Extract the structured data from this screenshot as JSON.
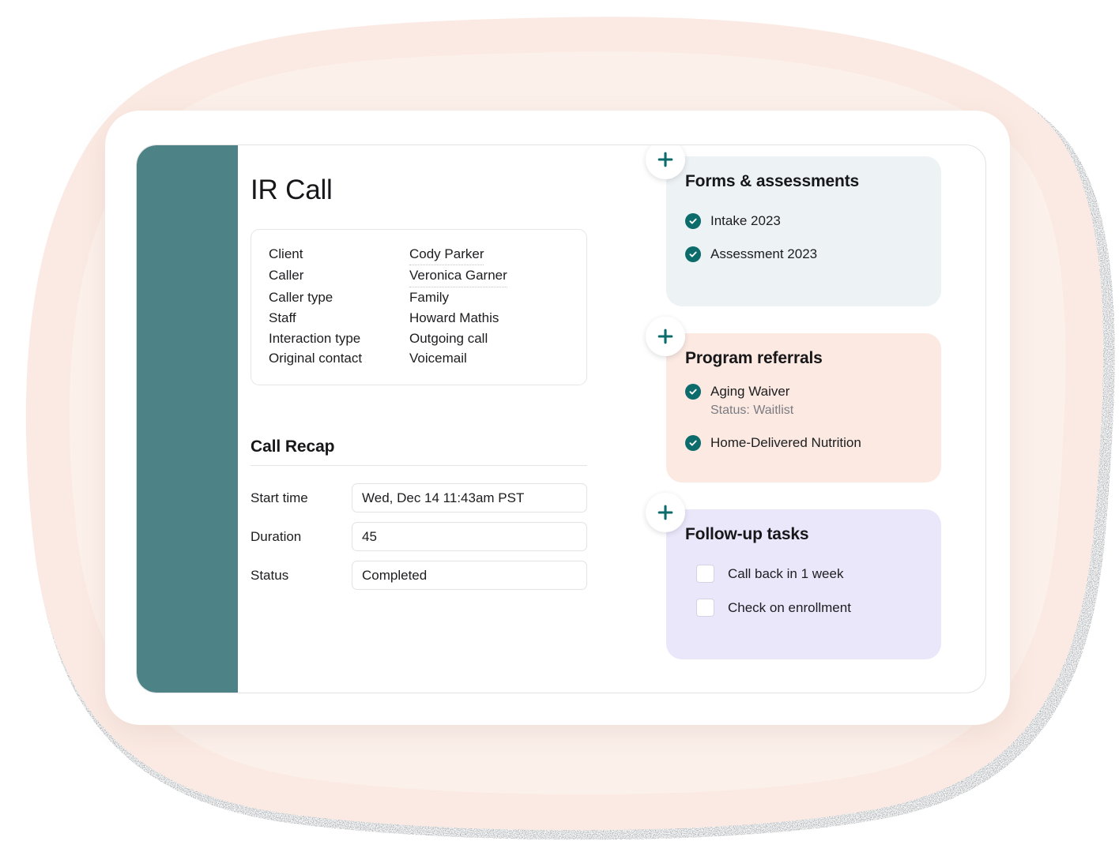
{
  "theme": {
    "rail_color": "#4d8386",
    "accent_teal": "#0c6b6b",
    "frame_color": "#ffffff",
    "blob_color": "#fbe9e2",
    "blob_shadow": "#2e3338",
    "card_forms_bg": "#edf2f5",
    "card_referrals_bg": "#fbe9e2",
    "card_tasks_bg": "#eae7fb"
  },
  "page": {
    "title": "IR Call"
  },
  "details": {
    "rows": [
      {
        "label": "Client",
        "value": "Cody Parker",
        "link": true
      },
      {
        "label": "Caller",
        "value": "Veronica Garner",
        "link": true
      },
      {
        "label": "Caller type",
        "value": "Family",
        "link": false
      },
      {
        "label": "Staff",
        "value": "Howard Mathis",
        "link": false
      },
      {
        "label": "Interaction type",
        "value": "Outgoing call",
        "link": false
      },
      {
        "label": "Original contact",
        "value": "Voicemail",
        "link": false
      }
    ]
  },
  "recap": {
    "heading": "Call Recap",
    "fields": [
      {
        "label": "Start time",
        "value": "Wed, Dec 14 11:43am PST"
      },
      {
        "label": "Duration",
        "value": "45"
      },
      {
        "label": "Status",
        "value": "Completed"
      }
    ]
  },
  "cards": {
    "forms": {
      "title": "Forms & assessments",
      "add_label": "+",
      "items": [
        {
          "label": "Intake 2023",
          "checked": true,
          "sub": ""
        },
        {
          "label": "Assessment 2023",
          "checked": true,
          "sub": ""
        }
      ]
    },
    "referrals": {
      "title": "Program referrals",
      "add_label": "+",
      "items": [
        {
          "label": "Aging Waiver",
          "checked": true,
          "sub": "Status: Waitlist"
        },
        {
          "label": "Home-Delivered Nutrition",
          "checked": true,
          "sub": ""
        }
      ]
    },
    "tasks": {
      "title": "Follow-up tasks",
      "add_label": "+",
      "items": [
        {
          "label": "Call back in 1 week",
          "checked": false
        },
        {
          "label": "Check on enrollment",
          "checked": false
        }
      ]
    }
  },
  "icons": {
    "plus": "plus-icon",
    "check": "check-circle-icon",
    "checkbox": "checkbox-empty-icon"
  }
}
